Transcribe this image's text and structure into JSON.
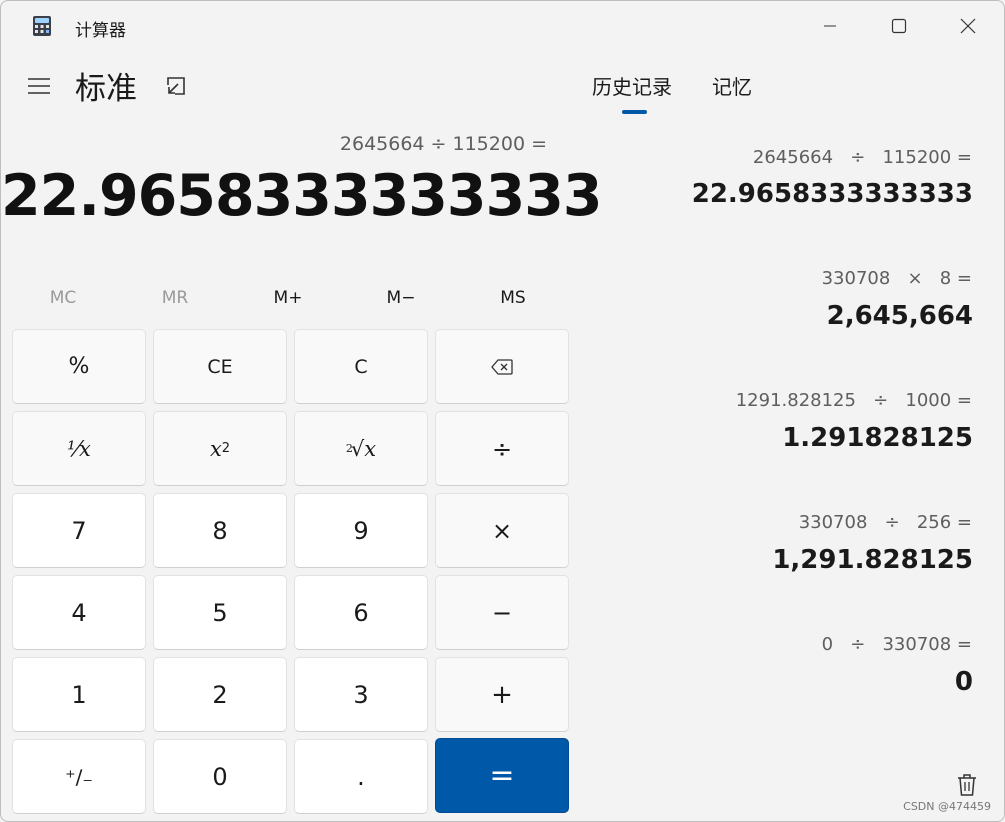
{
  "window": {
    "title": "计算器"
  },
  "header": {
    "mode": "标准",
    "tabs": [
      {
        "label": "历史记录",
        "active": true
      },
      {
        "label": "记忆",
        "active": false
      }
    ]
  },
  "display": {
    "expression": "2645664 ÷ 115200 =",
    "result": "22.9658333333333"
  },
  "memory": [
    {
      "label": "MC",
      "enabled": false
    },
    {
      "label": "MR",
      "enabled": false
    },
    {
      "label": "M+",
      "enabled": true
    },
    {
      "label": "M−",
      "enabled": true
    },
    {
      "label": "MS",
      "enabled": true
    }
  ],
  "keys": {
    "percent": "%",
    "ce": "CE",
    "c": "C",
    "reciprocal": "⅟x",
    "square_base": "x",
    "square_exp": "2",
    "root_index": "2",
    "root_body": "√x",
    "divide": "÷",
    "multiply": "×",
    "minus": "−",
    "plus": "+",
    "seven": "7",
    "eight": "8",
    "nine": "9",
    "four": "4",
    "five": "5",
    "six": "6",
    "one": "1",
    "two": "2",
    "three": "3",
    "negate": "⁺∕₋",
    "zero": "0",
    "decimal": ".",
    "equals": "="
  },
  "history": [
    {
      "expression": "2645664   ÷   115200 =",
      "result": "22.9658333333333"
    },
    {
      "expression": "330708   ×   8 =",
      "result": "2,645,664"
    },
    {
      "expression": "1291.828125   ÷   1000 =",
      "result": "1.291828125"
    },
    {
      "expression": "330708   ÷   256 =",
      "result": "1,291.828125"
    },
    {
      "expression": "0   ÷   330708 =",
      "result": "0"
    }
  ],
  "watermark": "CSDN @474459",
  "colors": {
    "accent": "#0058a8",
    "background": "#f3f3f3"
  }
}
